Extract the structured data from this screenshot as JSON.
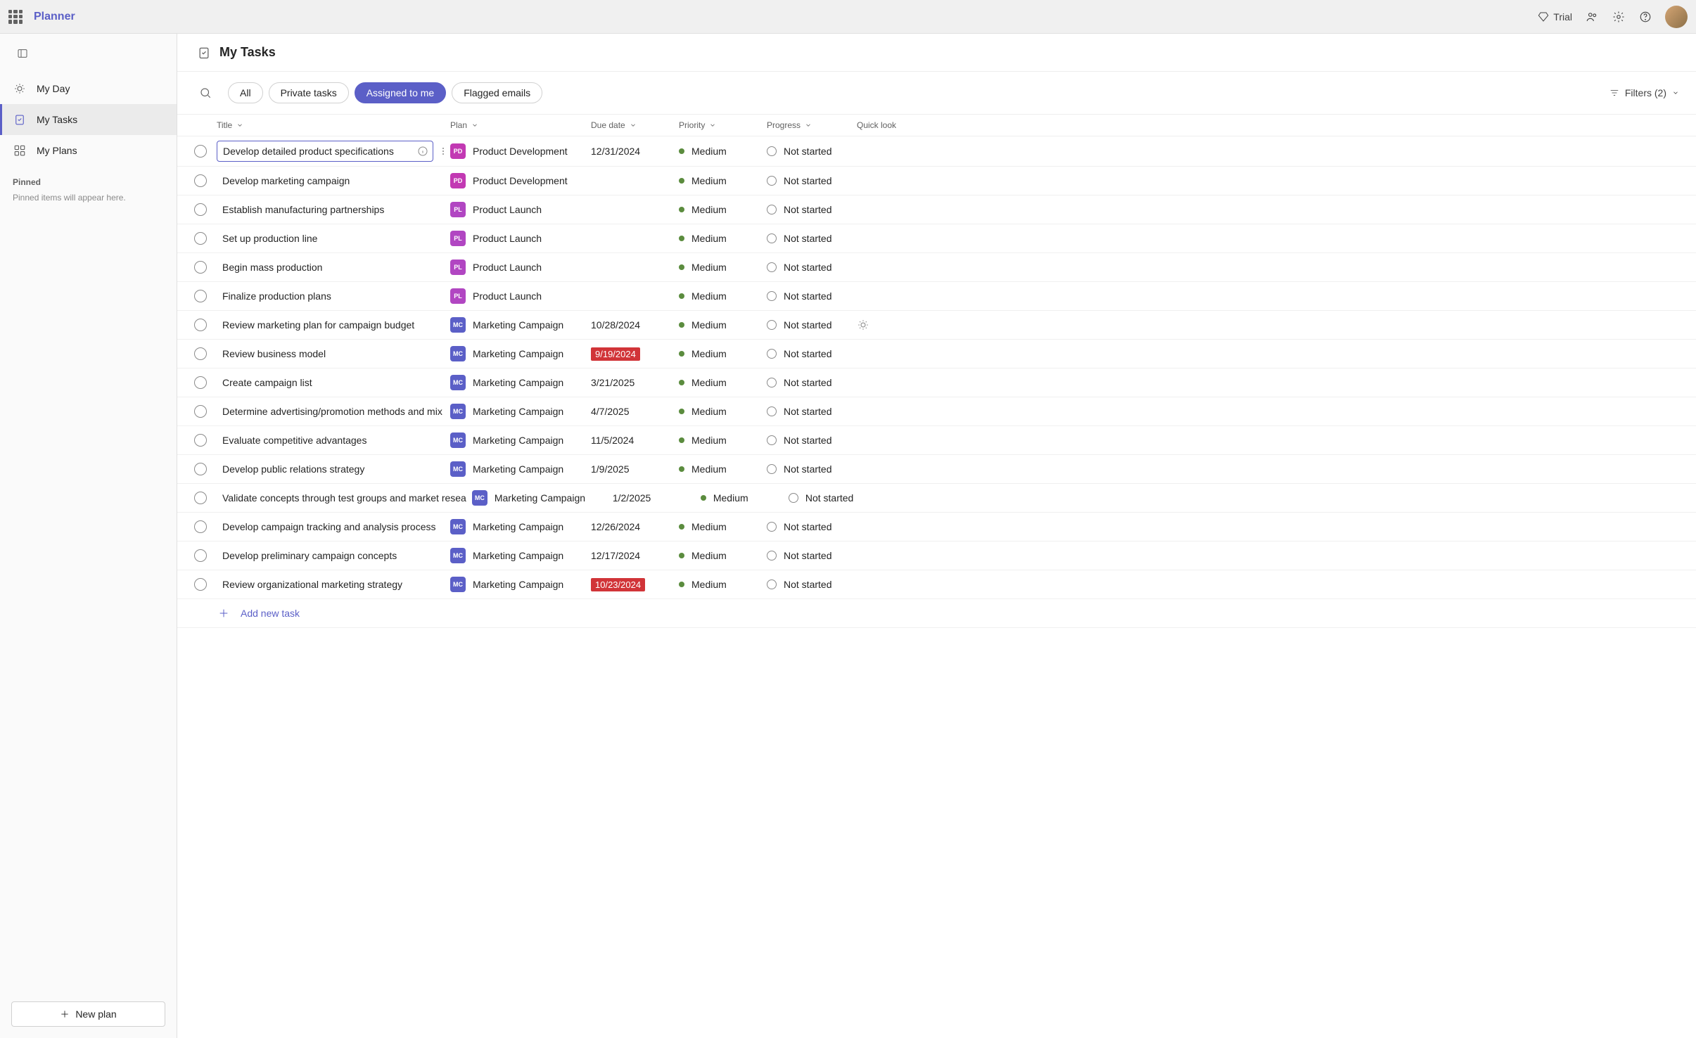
{
  "header": {
    "app_name": "Planner",
    "trial_label": "Trial"
  },
  "sidebar": {
    "nav": [
      {
        "id": "my-day",
        "label": "My Day"
      },
      {
        "id": "my-tasks",
        "label": "My Tasks"
      },
      {
        "id": "my-plans",
        "label": "My Plans"
      }
    ],
    "pinned_header": "Pinned",
    "pinned_empty": "Pinned items will appear here.",
    "new_plan": "New plan"
  },
  "page": {
    "title": "My Tasks"
  },
  "toolbar": {
    "filters": [
      {
        "id": "all",
        "label": "All"
      },
      {
        "id": "private",
        "label": "Private tasks"
      },
      {
        "id": "assigned",
        "label": "Assigned to me"
      },
      {
        "id": "flagged",
        "label": "Flagged emails"
      }
    ],
    "filters_label": "Filters (2)"
  },
  "columns": {
    "title": "Title",
    "plan": "Plan",
    "due": "Due date",
    "priority": "Priority",
    "progress": "Progress",
    "quick": "Quick look"
  },
  "tasks": [
    {
      "title": "Develop detailed product specifications",
      "plan": "Product Development",
      "plan_abbr": "PD",
      "plan_class": "pd",
      "due": "12/31/2024",
      "overdue": false,
      "priority": "Medium",
      "progress": "Not started",
      "selected": true,
      "quick": false
    },
    {
      "title": "Develop marketing campaign",
      "plan": "Product Development",
      "plan_abbr": "PD",
      "plan_class": "pd",
      "due": "",
      "overdue": false,
      "priority": "Medium",
      "progress": "Not started",
      "selected": false,
      "quick": false
    },
    {
      "title": "Establish manufacturing partnerships",
      "plan": "Product Launch",
      "plan_abbr": "PL",
      "plan_class": "pl",
      "due": "",
      "overdue": false,
      "priority": "Medium",
      "progress": "Not started",
      "selected": false,
      "quick": false
    },
    {
      "title": "Set up production line",
      "plan": "Product Launch",
      "plan_abbr": "PL",
      "plan_class": "pl",
      "due": "",
      "overdue": false,
      "priority": "Medium",
      "progress": "Not started",
      "selected": false,
      "quick": false
    },
    {
      "title": "Begin mass production",
      "plan": "Product Launch",
      "plan_abbr": "PL",
      "plan_class": "pl",
      "due": "",
      "overdue": false,
      "priority": "Medium",
      "progress": "Not started",
      "selected": false,
      "quick": false
    },
    {
      "title": "Finalize production plans",
      "plan": "Product Launch",
      "plan_abbr": "PL",
      "plan_class": "pl",
      "due": "",
      "overdue": false,
      "priority": "Medium",
      "progress": "Not started",
      "selected": false,
      "quick": false
    },
    {
      "title": "Review marketing plan for campaign budget",
      "plan": "Marketing Campaign",
      "plan_abbr": "MC",
      "plan_class": "mc",
      "due": "10/28/2024",
      "overdue": false,
      "priority": "Medium",
      "progress": "Not started",
      "selected": false,
      "quick": true
    },
    {
      "title": "Review business model",
      "plan": "Marketing Campaign",
      "plan_abbr": "MC",
      "plan_class": "mc",
      "due": "9/19/2024",
      "overdue": true,
      "priority": "Medium",
      "progress": "Not started",
      "selected": false,
      "quick": false
    },
    {
      "title": "Create campaign list",
      "plan": "Marketing Campaign",
      "plan_abbr": "MC",
      "plan_class": "mc",
      "due": "3/21/2025",
      "overdue": false,
      "priority": "Medium",
      "progress": "Not started",
      "selected": false,
      "quick": false
    },
    {
      "title": "Determine advertising/promotion methods and mix",
      "plan": "Marketing Campaign",
      "plan_abbr": "MC",
      "plan_class": "mc",
      "due": "4/7/2025",
      "overdue": false,
      "priority": "Medium",
      "progress": "Not started",
      "selected": false,
      "quick": false
    },
    {
      "title": "Evaluate competitive advantages",
      "plan": "Marketing Campaign",
      "plan_abbr": "MC",
      "plan_class": "mc",
      "due": "11/5/2024",
      "overdue": false,
      "priority": "Medium",
      "progress": "Not started",
      "selected": false,
      "quick": false
    },
    {
      "title": "Develop public relations strategy",
      "plan": "Marketing Campaign",
      "plan_abbr": "MC",
      "plan_class": "mc",
      "due": "1/9/2025",
      "overdue": false,
      "priority": "Medium",
      "progress": "Not started",
      "selected": false,
      "quick": false
    },
    {
      "title": "Validate concepts through test groups and market resea",
      "plan": "Marketing Campaign",
      "plan_abbr": "MC",
      "plan_class": "mc",
      "due": "1/2/2025",
      "overdue": false,
      "priority": "Medium",
      "progress": "Not started",
      "selected": false,
      "quick": false
    },
    {
      "title": "Develop campaign tracking and analysis process",
      "plan": "Marketing Campaign",
      "plan_abbr": "MC",
      "plan_class": "mc",
      "due": "12/26/2024",
      "overdue": false,
      "priority": "Medium",
      "progress": "Not started",
      "selected": false,
      "quick": false
    },
    {
      "title": "Develop preliminary campaign concepts",
      "plan": "Marketing Campaign",
      "plan_abbr": "MC",
      "plan_class": "mc",
      "due": "12/17/2024",
      "overdue": false,
      "priority": "Medium",
      "progress": "Not started",
      "selected": false,
      "quick": false
    },
    {
      "title": "Review organizational marketing strategy",
      "plan": "Marketing Campaign",
      "plan_abbr": "MC",
      "plan_class": "mc",
      "due": "10/23/2024",
      "overdue": true,
      "priority": "Medium",
      "progress": "Not started",
      "selected": false,
      "quick": false
    }
  ],
  "add_task": "Add new task"
}
